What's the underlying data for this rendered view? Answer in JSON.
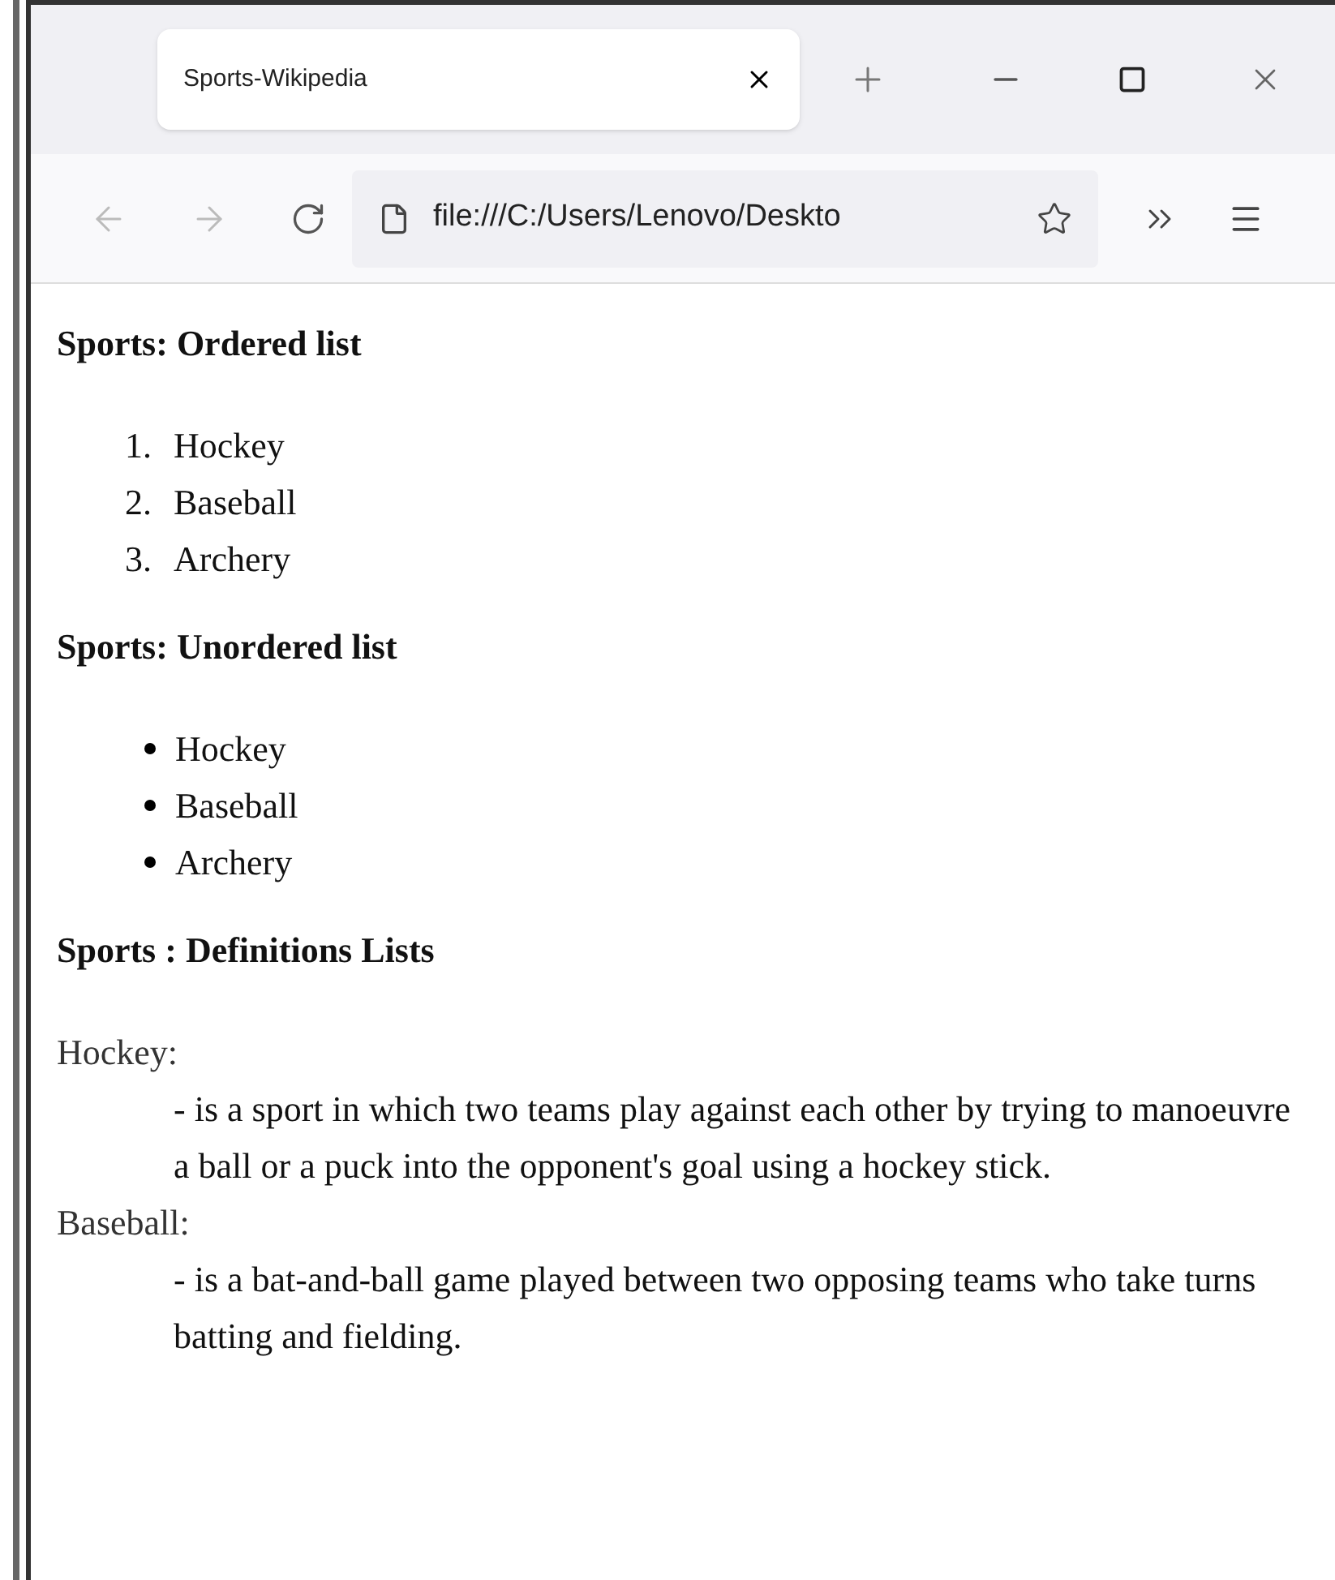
{
  "window": {
    "tab_title": "Sports-Wikipedia",
    "address": "file:///C:/Users/Lenovo/Deskto"
  },
  "sections": [
    {
      "kind": "ordered",
      "heading": "Sports: Ordered list",
      "items": [
        {
          "marker": "1.",
          "text": "Hockey"
        },
        {
          "marker": "2.",
          "text": "Baseball"
        },
        {
          "marker": "3.",
          "text": "Archery"
        }
      ]
    },
    {
      "kind": "unordered",
      "heading": "Sports: Unordered list",
      "items": [
        {
          "text": "Hockey"
        },
        {
          "text": "Baseball"
        },
        {
          "text": "Archery"
        }
      ]
    },
    {
      "kind": "definitions",
      "heading": "Sports : Definitions Lists",
      "items": [
        {
          "term": "Hockey:",
          "definition": "- is a sport in which two teams play against each other by trying to manoeuvre a ball or a puck into the opponent's goal using a hockey stick."
        },
        {
          "term": "Baseball:",
          "definition": "- is a bat-and-ball game played between two opposing teams who take turns batting and fielding."
        }
      ]
    }
  ]
}
